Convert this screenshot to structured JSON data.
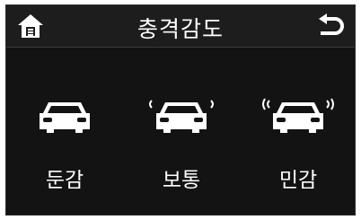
{
  "header": {
    "title": "충격감도",
    "home_icon": "home-icon",
    "back_icon": "back-icon"
  },
  "options": [
    {
      "label": "둔감",
      "icon": "car-icon"
    },
    {
      "label": "보통",
      "icon": "car-vibration-icon"
    },
    {
      "label": "민감",
      "icon": "car-strong-vibration-icon"
    }
  ],
  "colors": {
    "background": "#131313",
    "header": "#1d1d1d",
    "text": "#ffffff"
  }
}
